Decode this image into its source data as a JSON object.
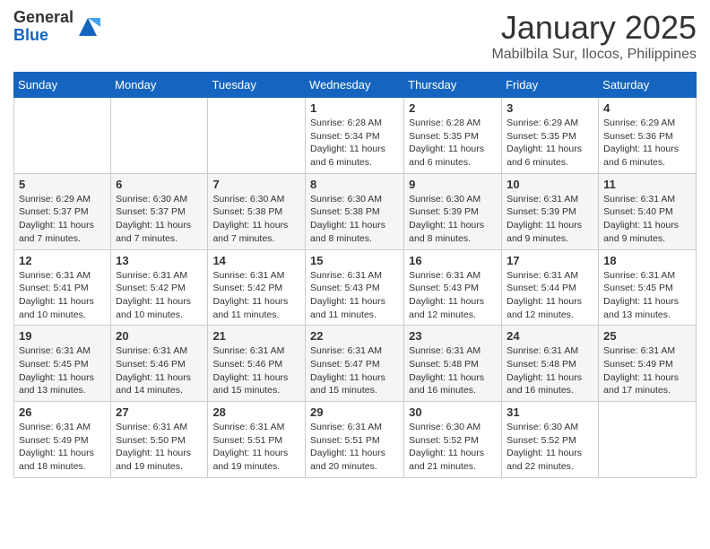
{
  "header": {
    "logo_general": "General",
    "logo_blue": "Blue",
    "month_title": "January 2025",
    "location": "Mabilbila Sur, Ilocos, Philippines"
  },
  "days_of_week": [
    "Sunday",
    "Monday",
    "Tuesday",
    "Wednesday",
    "Thursday",
    "Friday",
    "Saturday"
  ],
  "weeks": [
    [
      {
        "day": "",
        "info": ""
      },
      {
        "day": "",
        "info": ""
      },
      {
        "day": "",
        "info": ""
      },
      {
        "day": "1",
        "info": "Sunrise: 6:28 AM\nSunset: 5:34 PM\nDaylight: 11 hours and 6 minutes."
      },
      {
        "day": "2",
        "info": "Sunrise: 6:28 AM\nSunset: 5:35 PM\nDaylight: 11 hours and 6 minutes."
      },
      {
        "day": "3",
        "info": "Sunrise: 6:29 AM\nSunset: 5:35 PM\nDaylight: 11 hours and 6 minutes."
      },
      {
        "day": "4",
        "info": "Sunrise: 6:29 AM\nSunset: 5:36 PM\nDaylight: 11 hours and 6 minutes."
      }
    ],
    [
      {
        "day": "5",
        "info": "Sunrise: 6:29 AM\nSunset: 5:37 PM\nDaylight: 11 hours and 7 minutes."
      },
      {
        "day": "6",
        "info": "Sunrise: 6:30 AM\nSunset: 5:37 PM\nDaylight: 11 hours and 7 minutes."
      },
      {
        "day": "7",
        "info": "Sunrise: 6:30 AM\nSunset: 5:38 PM\nDaylight: 11 hours and 7 minutes."
      },
      {
        "day": "8",
        "info": "Sunrise: 6:30 AM\nSunset: 5:38 PM\nDaylight: 11 hours and 8 minutes."
      },
      {
        "day": "9",
        "info": "Sunrise: 6:30 AM\nSunset: 5:39 PM\nDaylight: 11 hours and 8 minutes."
      },
      {
        "day": "10",
        "info": "Sunrise: 6:31 AM\nSunset: 5:39 PM\nDaylight: 11 hours and 9 minutes."
      },
      {
        "day": "11",
        "info": "Sunrise: 6:31 AM\nSunset: 5:40 PM\nDaylight: 11 hours and 9 minutes."
      }
    ],
    [
      {
        "day": "12",
        "info": "Sunrise: 6:31 AM\nSunset: 5:41 PM\nDaylight: 11 hours and 10 minutes."
      },
      {
        "day": "13",
        "info": "Sunrise: 6:31 AM\nSunset: 5:42 PM\nDaylight: 11 hours and 10 minutes."
      },
      {
        "day": "14",
        "info": "Sunrise: 6:31 AM\nSunset: 5:42 PM\nDaylight: 11 hours and 11 minutes."
      },
      {
        "day": "15",
        "info": "Sunrise: 6:31 AM\nSunset: 5:43 PM\nDaylight: 11 hours and 11 minutes."
      },
      {
        "day": "16",
        "info": "Sunrise: 6:31 AM\nSunset: 5:43 PM\nDaylight: 11 hours and 12 minutes."
      },
      {
        "day": "17",
        "info": "Sunrise: 6:31 AM\nSunset: 5:44 PM\nDaylight: 11 hours and 12 minutes."
      },
      {
        "day": "18",
        "info": "Sunrise: 6:31 AM\nSunset: 5:45 PM\nDaylight: 11 hours and 13 minutes."
      }
    ],
    [
      {
        "day": "19",
        "info": "Sunrise: 6:31 AM\nSunset: 5:45 PM\nDaylight: 11 hours and 13 minutes."
      },
      {
        "day": "20",
        "info": "Sunrise: 6:31 AM\nSunset: 5:46 PM\nDaylight: 11 hours and 14 minutes."
      },
      {
        "day": "21",
        "info": "Sunrise: 6:31 AM\nSunset: 5:46 PM\nDaylight: 11 hours and 15 minutes."
      },
      {
        "day": "22",
        "info": "Sunrise: 6:31 AM\nSunset: 5:47 PM\nDaylight: 11 hours and 15 minutes."
      },
      {
        "day": "23",
        "info": "Sunrise: 6:31 AM\nSunset: 5:48 PM\nDaylight: 11 hours and 16 minutes."
      },
      {
        "day": "24",
        "info": "Sunrise: 6:31 AM\nSunset: 5:48 PM\nDaylight: 11 hours and 16 minutes."
      },
      {
        "day": "25",
        "info": "Sunrise: 6:31 AM\nSunset: 5:49 PM\nDaylight: 11 hours and 17 minutes."
      }
    ],
    [
      {
        "day": "26",
        "info": "Sunrise: 6:31 AM\nSunset: 5:49 PM\nDaylight: 11 hours and 18 minutes."
      },
      {
        "day": "27",
        "info": "Sunrise: 6:31 AM\nSunset: 5:50 PM\nDaylight: 11 hours and 19 minutes."
      },
      {
        "day": "28",
        "info": "Sunrise: 6:31 AM\nSunset: 5:51 PM\nDaylight: 11 hours and 19 minutes."
      },
      {
        "day": "29",
        "info": "Sunrise: 6:31 AM\nSunset: 5:51 PM\nDaylight: 11 hours and 20 minutes."
      },
      {
        "day": "30",
        "info": "Sunrise: 6:30 AM\nSunset: 5:52 PM\nDaylight: 11 hours and 21 minutes."
      },
      {
        "day": "31",
        "info": "Sunrise: 6:30 AM\nSunset: 5:52 PM\nDaylight: 11 hours and 22 minutes."
      },
      {
        "day": "",
        "info": ""
      }
    ]
  ]
}
